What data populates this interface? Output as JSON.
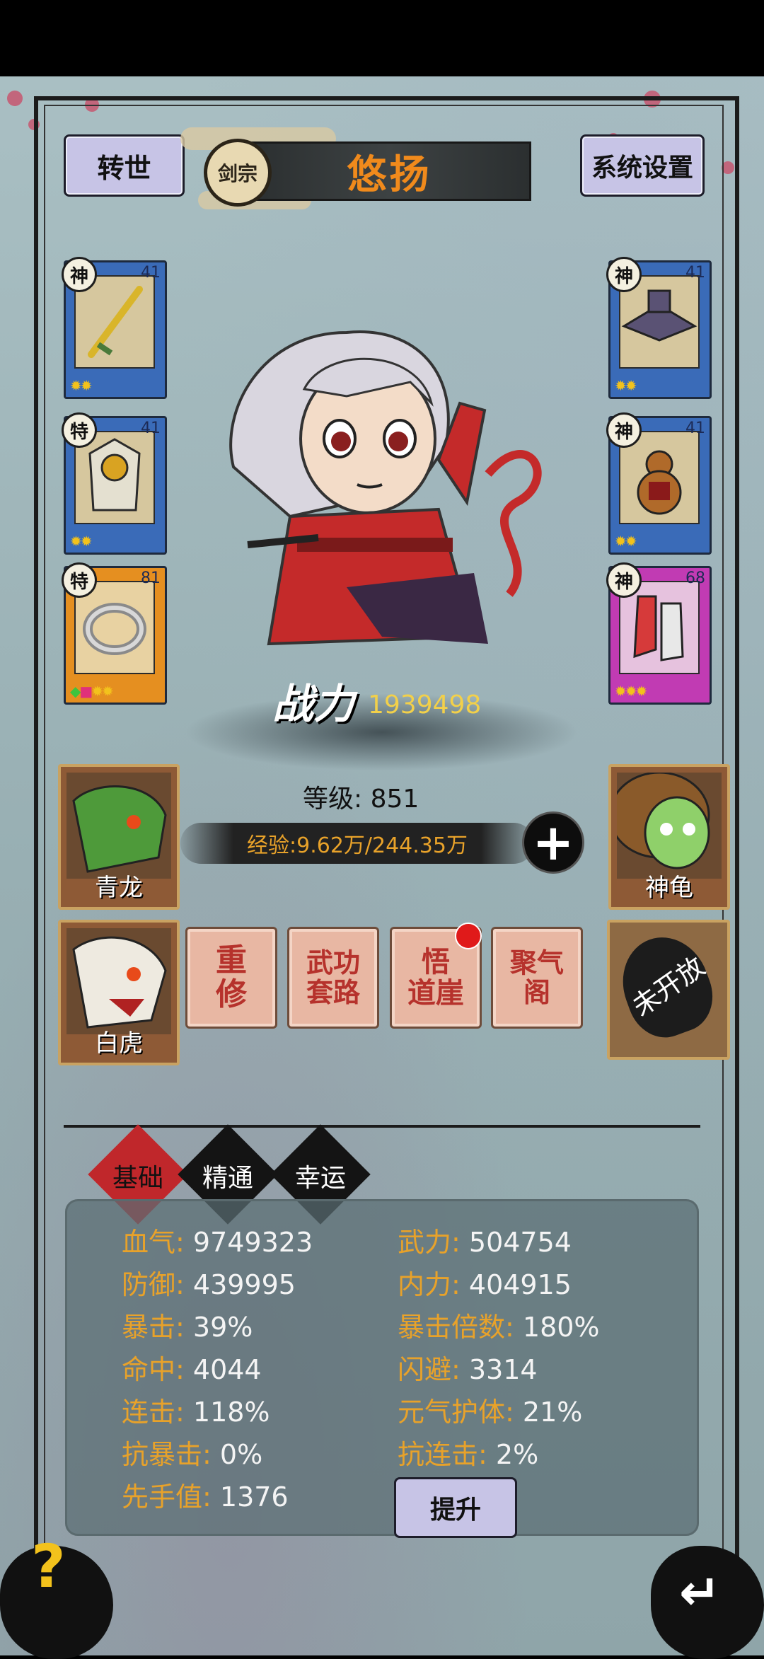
{
  "header": {
    "rebirth_label": "转世",
    "sect_badge": "剑宗",
    "player_name": "悠扬",
    "settings_label": "系统设置"
  },
  "equipment": {
    "left": [
      {
        "tier": "神",
        "level": "41",
        "item": "sword"
      },
      {
        "tier": "特",
        "level": "41",
        "item": "armor"
      },
      {
        "tier": "特",
        "level": "81",
        "item": "ring"
      }
    ],
    "right": [
      {
        "tier": "神",
        "level": "41",
        "item": "hat"
      },
      {
        "tier": "神",
        "level": "41",
        "item": "gourd"
      },
      {
        "tier": "神",
        "level": "68",
        "item": "boots"
      }
    ]
  },
  "combat_power": {
    "label": "战力",
    "value": "1939498"
  },
  "level": {
    "text": "等级: 851"
  },
  "experience": {
    "text": "经验:9.62万/244.35万"
  },
  "pets": {
    "qinglong": "青龙",
    "shengui": "神龟",
    "baihu": "白虎",
    "locked": "未开放"
  },
  "functions": [
    {
      "line1": "重",
      "line2": "修"
    },
    {
      "line1": "武功",
      "line2": "套路"
    },
    {
      "line1": "悟",
      "line2": "道崖"
    },
    {
      "line1": "聚气",
      "line2": "阁"
    }
  ],
  "tabs": [
    "基础",
    "精通",
    "幸运"
  ],
  "stats": {
    "left": [
      {
        "k": "血气:",
        "v": "9749323"
      },
      {
        "k": "防御:",
        "v": "439995"
      },
      {
        "k": "暴击:",
        "v": "39%"
      },
      {
        "k": "命中:",
        "v": "4044"
      },
      {
        "k": "连击:",
        "v": "118%"
      },
      {
        "k": "抗暴击:",
        "v": "0%"
      },
      {
        "k": "先手值:",
        "v": "1376"
      }
    ],
    "right": [
      {
        "k": "武力:",
        "v": "504754"
      },
      {
        "k": "内力:",
        "v": "404915"
      },
      {
        "k": "暴击倍数:",
        "v": "180%"
      },
      {
        "k": "闪避:",
        "v": "3314"
      },
      {
        "k": "元气护体:",
        "v": "21%"
      },
      {
        "k": "抗连击:",
        "v": "2%"
      }
    ]
  },
  "raise_label": "提升",
  "help_label": "?",
  "colors": {
    "accent_orange": "#e8a22a",
    "title_orange": "#f08a1c",
    "tab_active": "#c0272b"
  }
}
